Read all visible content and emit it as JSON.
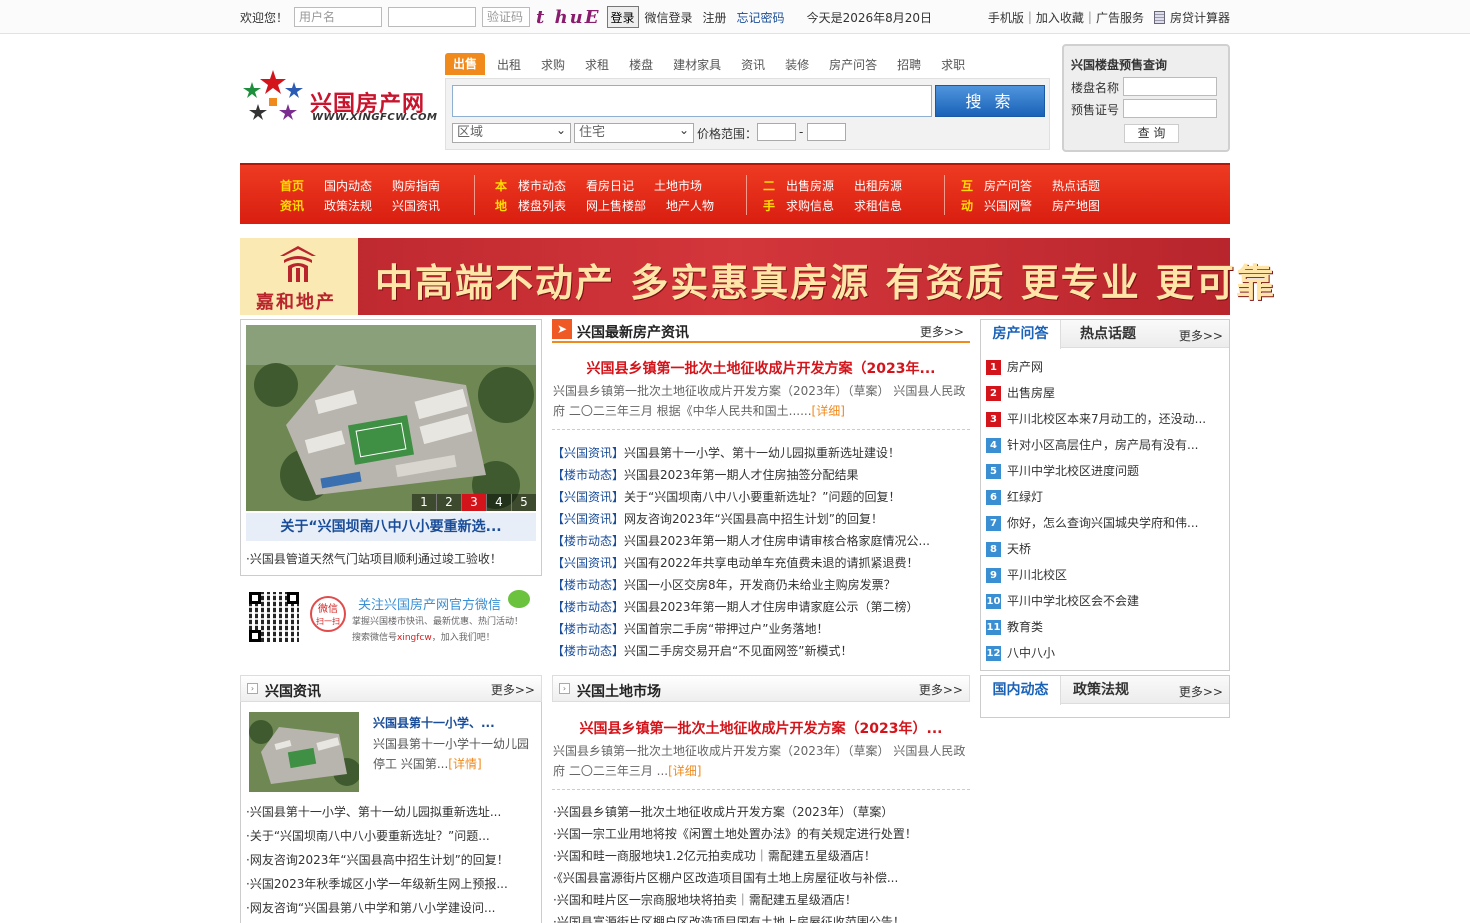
{
  "topbar": {
    "welcome": "欢迎您！",
    "username_placeholder": "用户名",
    "captcha_placeholder": "验证码",
    "captcha_text": "t huE",
    "login": "登录",
    "wechat_login": "微信登录",
    "register": "注册",
    "forgot": "忘记密码",
    "today": "今天是2026年8月20日",
    "mobile": "手机版",
    "favorite": "加入收藏",
    "ads": "广告服务",
    "calculator": "房贷计算器"
  },
  "logo": {
    "name": "兴国房产网",
    "url": "WWW.XINGFCW.COM"
  },
  "search": {
    "tabs": [
      "出售",
      "出租",
      "求购",
      "求租",
      "楼盘",
      "建材家具",
      "资讯",
      "装修",
      "房产问答",
      "招聘",
      "求职"
    ],
    "button": "搜 索",
    "region": "区域",
    "type": "住宅",
    "price_label": "价格范围：",
    "dash": "-"
  },
  "presale": {
    "title": "兴国楼盘预售查询",
    "name_label": "楼盘名称",
    "cert_label": "预售证号",
    "button": "查 询"
  },
  "nav": {
    "g1_a": "首页",
    "g1_b": "资讯",
    "g1_items": [
      "国内动态",
      "购房指南",
      "政策法规",
      "兴国资讯"
    ],
    "g2_a": "本",
    "g2_b": "地",
    "g2_items": [
      "楼市动态",
      "看房日记",
      "土地市场",
      "楼盘列表",
      "网上售楼部",
      "地产人物"
    ],
    "g3_a": "二",
    "g3_b": "手",
    "g3_items": [
      "出售房源",
      "出租房源",
      "求购信息",
      "求租信息"
    ],
    "g4_a": "互",
    "g4_b": "动",
    "g4_items": [
      "房产问答",
      "热点话题",
      "兴国网警",
      "房产地图"
    ]
  },
  "banner": {
    "brand": "嘉和地产",
    "slogan": "中高端不动产  多实惠真房源  有资质  更专业  更可靠"
  },
  "slider": {
    "pages": [
      "1",
      "2",
      "3",
      "4",
      "5"
    ],
    "active": 2,
    "caption": "关于“兴国坝南八中八小要重新选...",
    "news": "·兴国县管道天然气门站项目顺利通过竣工验收！"
  },
  "weixin": {
    "badge_a": "微信",
    "badge_b": "扫一扫",
    "title": "关注兴国房产网官方微信",
    "line1": "掌握兴国楼市快讯、最新优惠、热门活动！",
    "line2_a": "搜索微信号",
    "line2_b": "xingfcw",
    "line2_c": "，加入我们吧！"
  },
  "latest": {
    "title": "兴国最新房产资讯",
    "more": "更多>>",
    "headline": "兴国县乡镇第一批次土地征收成片开发方案（2023年...",
    "summary": "兴国县乡镇第一批次土地征收成片开发方案（2023年）（草案） 兴国县人民政府 二〇二三年三月 根据《中华人民共和国土......",
    "detail": "[详细]",
    "items": [
      {
        "cat": "【兴国资讯】",
        "text": "兴国县第十一小学、第十一幼儿园拟重新选址建设！"
      },
      {
        "cat": "【楼市动态】",
        "text": "兴国县2023年第一期人才住房抽签分配结果"
      },
      {
        "cat": "【兴国资讯】",
        "text": "关于“兴国坝南八中八小要重新选址？”问题的回复！"
      },
      {
        "cat": "【兴国资讯】",
        "text": "网友咨询2023年“兴国县高中招生计划”的回复！"
      },
      {
        "cat": "【楼市动态】",
        "text": "兴国县2023年第一期人才住房申请审核合格家庭情况公..."
      },
      {
        "cat": "【兴国资讯】",
        "text": "兴国有2022年共享电动单车充值费未退的请抓紧退费！"
      },
      {
        "cat": "【楼市动态】",
        "text": "兴国一小区交房8年，开发商仍未给业主购房发票？"
      },
      {
        "cat": "【楼市动态】",
        "text": "兴国县2023年第一期人才住房申请家庭公示（第二榜）"
      },
      {
        "cat": "【楼市动态】",
        "text": "兴国首宗二手房“带押过户”业务落地！"
      },
      {
        "cat": "【楼市动态】",
        "text": "兴国二手房交易开启“不见面网签”新模式！"
      }
    ]
  },
  "qa": {
    "tab1": "房产问答",
    "tab2": "热点话题",
    "more": "更多>>",
    "items": [
      {
        "n": "1",
        "text": "房产网"
      },
      {
        "n": "2",
        "text": "出售房屋"
      },
      {
        "n": "3",
        "text": "平川北校区本来7月动工的，还没动..."
      },
      {
        "n": "4",
        "text": "针对小区高层住户，房产局有没有..."
      },
      {
        "n": "5",
        "text": "平川中学北校区进度问题"
      },
      {
        "n": "6",
        "text": "红绿灯"
      },
      {
        "n": "7",
        "text": "你好，怎么查询兴国城央学府和伟..."
      },
      {
        "n": "8",
        "text": "天桥"
      },
      {
        "n": "9",
        "text": "平川北校区"
      },
      {
        "n": "10",
        "text": "平川中学北校区会不会建"
      },
      {
        "n": "11",
        "text": "教育类"
      },
      {
        "n": "12",
        "text": "八中八小"
      }
    ]
  },
  "domestic": {
    "tab1": "国内动态",
    "tab2": "政策法规",
    "more": "更多>>"
  },
  "xgnews": {
    "title": "兴国资讯",
    "more": "更多>>",
    "feat_title": "兴国县第十一小学、...",
    "feat_summary": "兴国县第十一小学十一幼儿园停工 兴国第...",
    "detail": "[详情]",
    "items": [
      "·兴国县第十一小学、第十一幼儿园拟重新选址...",
      "·关于“兴国坝南八中八小要重新选址？”问题...",
      "·网友咨询2023年“兴国县高中招生计划”的回复！",
      "·兴国2023年秋季城区小学一年级新生网上预报...",
      "·网友咨询“兴国县第八中学和第八小学建设问..."
    ]
  },
  "land": {
    "title": "兴国土地市场",
    "more": "更多>>",
    "headline": "兴国县乡镇第一批次土地征收成片开发方案（2023年）...",
    "summary": "兴国县乡镇第一批次土地征收成片开发方案（2023年）（草案） 兴国县人民政府 二〇二三年三月 ...",
    "detail": "[详细]",
    "items": [
      "·兴国县乡镇第一批次土地征收成片开发方案（2023年）（草案）",
      "·兴国一宗工业用地将按《闲置土地处置办法》的有关规定进行处置！",
      "·兴国和畦一商服地块1.2亿元拍卖成功｜需配建五星级酒店！",
      "·《兴国县富源街片区棚户区改造项目国有土地上房屋征收与补偿...",
      "·兴国和畦片区一宗商服地块将拍卖｜需配建五星级酒店！",
      "·兴国县富源街片区棚户区改造项目国有土地上房屋征收范围公告！"
    ]
  }
}
